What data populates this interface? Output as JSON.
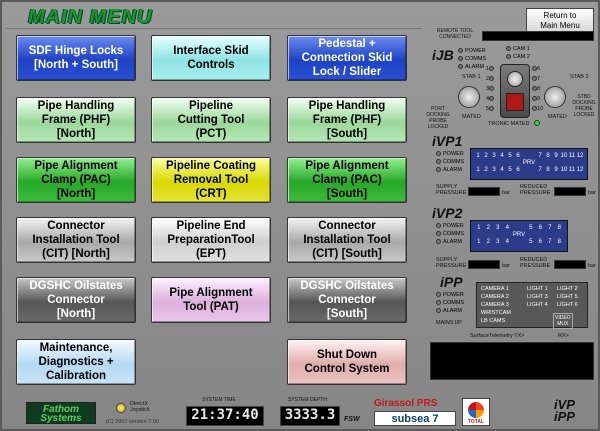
{
  "title": "MAIN MENU",
  "buttons": [
    {
      "id": "sdf-hinge-locks",
      "label": "SDF Hinge Locks\n[North + South]",
      "color": "b-blue"
    },
    {
      "id": "interface-skid",
      "label": "Interface Skid\nControls",
      "color": "b-cyan"
    },
    {
      "id": "pedestal",
      "label": "Pedestal +\nConnection Skid\nLock / Slider",
      "color": "b-blue"
    },
    {
      "id": "phf-north",
      "label": "Pipe Handling\nFrame (PHF)\n[North]",
      "color": "b-lgreen"
    },
    {
      "id": "pct",
      "label": "Pipeline\nCutting Tool\n(PCT)",
      "color": "b-lgreen"
    },
    {
      "id": "phf-south",
      "label": "Pipe Handling\nFrame (PHF)\n[South]",
      "color": "b-lgreen"
    },
    {
      "id": "pac-north",
      "label": "Pipe Alignment\nClamp (PAC)\n[North]",
      "color": "b-green"
    },
    {
      "id": "crt",
      "label": "Pipeline Coating\nRemoval Tool\n(CRT)",
      "color": "b-yellow"
    },
    {
      "id": "pac-south",
      "label": "Pipe Alignment\nClamp (PAC)\n[South]",
      "color": "b-green"
    },
    {
      "id": "cit-north",
      "label": "Connector\nInstallation Tool\n(CIT) [North]",
      "color": "b-grey"
    },
    {
      "id": "ept",
      "label": "Pipeline End\nPreparationTool\n(EPT)",
      "color": "b-lgrey"
    },
    {
      "id": "cit-south",
      "label": "Connector\nInstallation Tool\n(CIT) [South]",
      "color": "b-grey"
    },
    {
      "id": "dgshc-north",
      "label": "DGSHC Oilstates\nConnector\n[North]",
      "color": "b-dgrey"
    },
    {
      "id": "pat",
      "label": "Pipe Alignment\nTool (PAT)",
      "color": "b-pink"
    },
    {
      "id": "dgshc-south",
      "label": "DGSHC Oilstates\nConnector\n[South]",
      "color": "b-dgrey"
    },
    {
      "id": "maintenance",
      "label": "Maintenance,\nDiagnostics +\nCalibration",
      "color": "b-lblue"
    },
    {
      "id": "shutdown",
      "label": "Shut Down\nControl System",
      "color": "b-rose"
    }
  ],
  "right": {
    "return_label": "Return to\nMain Menu",
    "remote_tool": "REMOTE TOOL\nCONNECTED",
    "ijb": {
      "title": "iJB",
      "leds": [
        "POWER",
        "COMMS",
        "ALARM"
      ],
      "cams": [
        "CAM 1",
        "CAM 2"
      ],
      "stab1": "STAB 1",
      "stab2": "STAB 2",
      "port_docking": "PORT\nDOCKING\nPROBE\nLOCKED",
      "stbd_docking": "STBD\nDOCKING\nPROBE\nLOCKED",
      "mated_left": "MATED",
      "mated_right": "MATED",
      "tronic_mated": "TRONIC MATED",
      "numbers": [
        "1",
        "2",
        "3",
        "4",
        "5",
        "6",
        "7",
        "8",
        "9",
        "10"
      ]
    },
    "ivp1": {
      "title": "iVP1",
      "leds": [
        "POWER",
        "COMMS",
        "ALARM"
      ],
      "row1": [
        "1",
        "2",
        "3",
        "4",
        "5",
        "6",
        "7",
        "8",
        "9",
        "10",
        "11",
        "12"
      ],
      "row2": [
        "1",
        "2",
        "3",
        "4",
        "5",
        "6",
        "7",
        "8",
        "9",
        "10",
        "11",
        "12"
      ],
      "prv": "PRV",
      "supply": "SUPPLY\nPRESSURE",
      "reduced": "REDUCED\nPRESSURE",
      "unit": "bar"
    },
    "ivp2": {
      "title": "iVP2",
      "leds": [
        "POWER",
        "COMMS",
        "ALARM"
      ],
      "row1": [
        "1",
        "2",
        "3",
        "4",
        "5",
        "6",
        "7",
        "8"
      ],
      "row2": [
        "1",
        "2",
        "3",
        "4",
        "5",
        "6",
        "7",
        "8"
      ],
      "prv": "PRV",
      "supply": "SUPPLY\nPRESSURE",
      "reduced": "REDUCED\nPRESSURE",
      "unit": "bar"
    },
    "ipp": {
      "title": "iPP",
      "leds": [
        "POWER",
        "COMMS",
        "ALARM"
      ],
      "cameras": [
        "CAMERA 1",
        "CAMERA 2",
        "CAMERA 3",
        "WRISTCAM",
        "LB CAMS"
      ],
      "lights": [
        "LIGHT 1",
        "LIGHT 2",
        "LIGHT 3",
        "LIGHT 5",
        "LIGHT 4",
        "LIGHT 6"
      ],
      "video_mux": "VIDEO\nMUX",
      "mains": "MAINS I/P",
      "telemetry": "SurfaceTelemetry TX>",
      "rx": "RX>"
    },
    "footer": "iVP\niPP"
  },
  "bottom": {
    "fathom": "Fathom\nSystems",
    "directx": "DirectX\nJoystick",
    "copyright": "(C) 2007 version 7.00",
    "system_time_label": "SYSTEM TIME",
    "system_time": "21:37:40",
    "system_depth_label": "SYSTEM DEPTH",
    "system_depth": "3333.3",
    "depth_unit": "FSW",
    "girassol": "Girassol PRS",
    "subsea7": "subsea 7",
    "total": "TOTAL"
  }
}
